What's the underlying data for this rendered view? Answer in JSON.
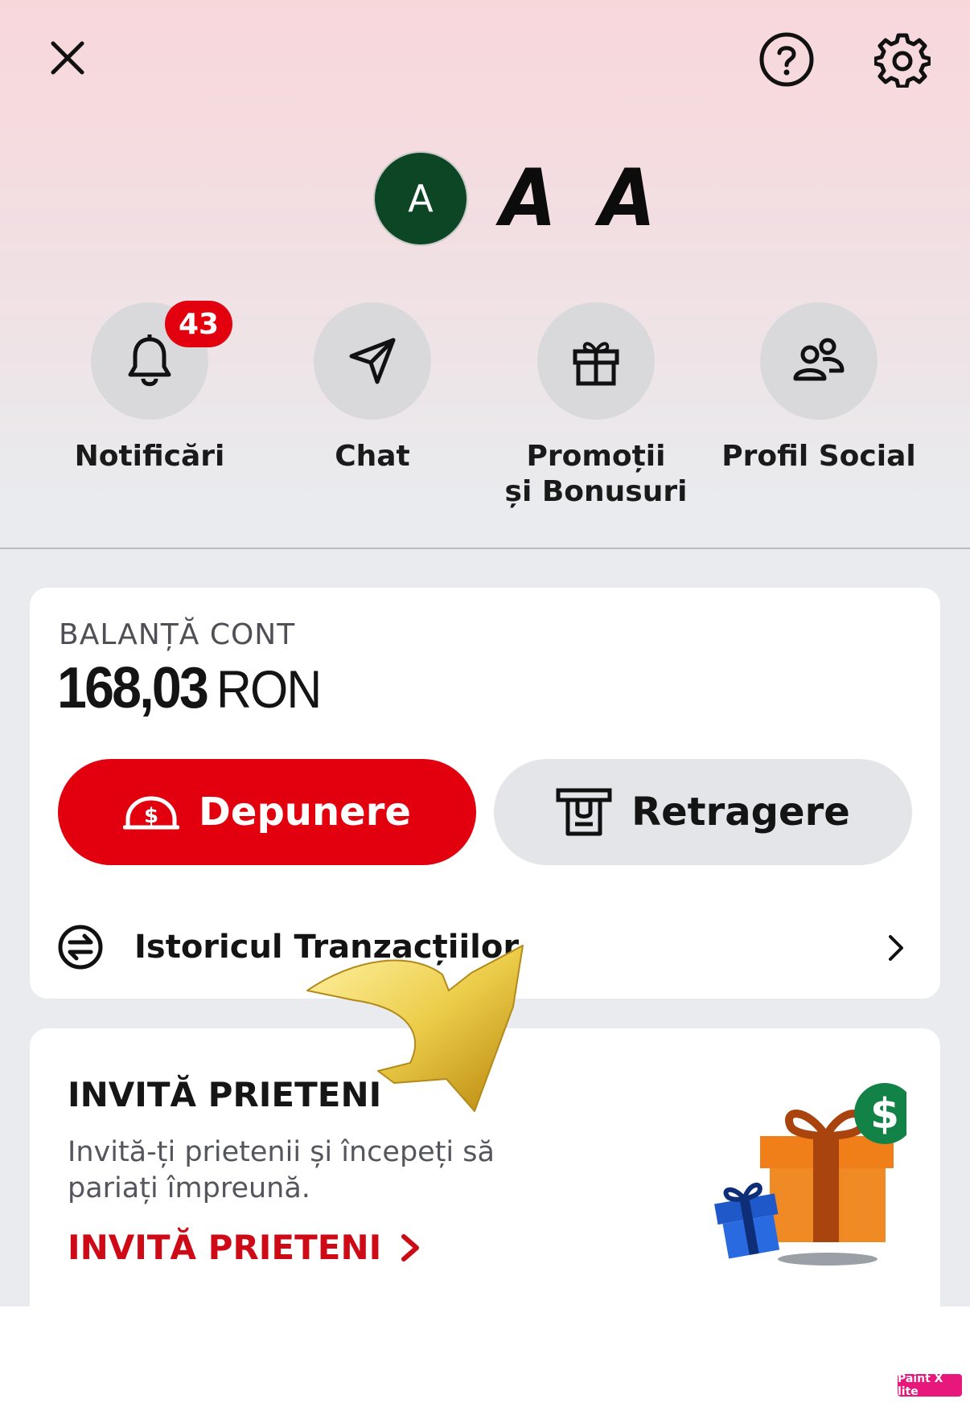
{
  "profile": {
    "avatar_initial": "A",
    "display_name": "A A"
  },
  "quick_actions": [
    {
      "label": "Notificări",
      "icon": "bell-icon",
      "badge": "43"
    },
    {
      "label": "Chat",
      "icon": "send-icon"
    },
    {
      "label": "Promoții\nși Bonusuri",
      "icon": "gift-icon"
    },
    {
      "label": "Profil Social",
      "icon": "people-icon"
    }
  ],
  "balance": {
    "label": "BALANȚĂ CONT",
    "amount": "168,03",
    "currency": "RON"
  },
  "actions": {
    "deposit_label": "Depunere",
    "withdraw_label": "Retragere"
  },
  "history": {
    "label": "Istoricul Tranzacțiilor"
  },
  "invite": {
    "title": "INVITĂ PRIETENI",
    "description": "Invită-ți prietenii și începeți să pariați împreună.",
    "link_label": "INVITĂ PRIETENI"
  },
  "watermark": "Paint X lite",
  "colors": {
    "brand_red": "#e2000f",
    "avatar_green": "#0d4624",
    "annotation_gold": "#e8c23a"
  }
}
